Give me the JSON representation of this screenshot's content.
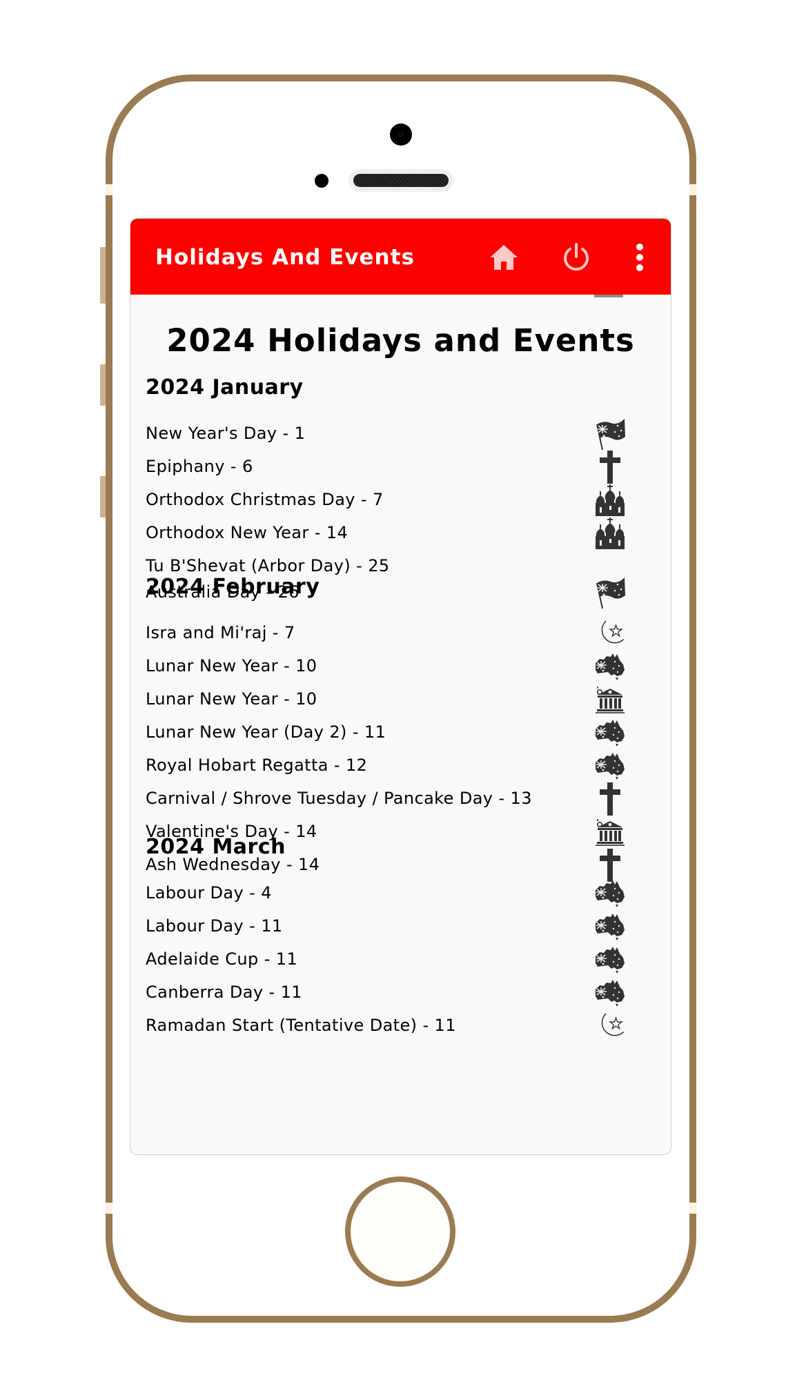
{
  "app": {
    "title": "Holidays And Events",
    "actions": [
      {
        "name": "home-icon",
        "label": "Home"
      },
      {
        "name": "power-icon",
        "label": "Exit"
      },
      {
        "name": "more-vert-icon",
        "label": "More options"
      }
    ]
  },
  "colors": {
    "appbar": "#fd0000",
    "icon_tint": "#ffc9c9",
    "phone_frame": "#9b7b52",
    "list_icon": "#333333"
  },
  "page": {
    "title": "2024 Holidays and Events",
    "months": [
      {
        "heading": "2024 January",
        "items": [
          {
            "text": "New Year's Day - 1",
            "icon": "australia-flag-icon"
          },
          {
            "text": "Epiphany - 6",
            "icon": "christian-cross-icon"
          },
          {
            "text": "Orthodox Christmas Day - 7",
            "icon": "orthodox-church-icon"
          },
          {
            "text": "Orthodox New Year - 14",
            "icon": "orthodox-church-icon"
          },
          {
            "text": "Tu B'Shevat (Arbor Day) - 25",
            "icon": ""
          },
          {
            "text": "Australia Day - 26",
            "icon": "australia-flag-icon"
          }
        ]
      },
      {
        "heading": "2024 February",
        "items": [
          {
            "text": "Isra and Mi'raj - 7",
            "icon": "crescent-star-icon"
          },
          {
            "text": "Lunar New Year - 10",
            "icon": "australia-map-icon"
          },
          {
            "text": "Lunar New Year - 10",
            "icon": "bank-building-icon"
          },
          {
            "text": "Lunar New Year (Day 2) - 11",
            "icon": "australia-map-icon"
          },
          {
            "text": "Royal Hobart Regatta - 12",
            "icon": "australia-map-icon"
          },
          {
            "text": "Carnival / Shrove Tuesday / Pancake Day - 13",
            "icon": "christian-cross-icon"
          },
          {
            "text": "Valentine's Day - 14",
            "icon": "bank-building-icon"
          },
          {
            "text": "Ash Wednesday - 14",
            "icon": "christian-cross-icon"
          }
        ]
      },
      {
        "heading": "2024 March",
        "items": [
          {
            "text": "Labour Day - 4",
            "icon": "australia-map-icon"
          },
          {
            "text": "Labour Day - 11",
            "icon": "australia-map-icon"
          },
          {
            "text": "Adelaide Cup - 11",
            "icon": "australia-map-icon"
          },
          {
            "text": "Canberra Day - 11",
            "icon": "australia-map-icon"
          },
          {
            "text": "Ramadan Start (Tentative Date) - 11",
            "icon": "crescent-star-icon"
          }
        ]
      }
    ]
  }
}
